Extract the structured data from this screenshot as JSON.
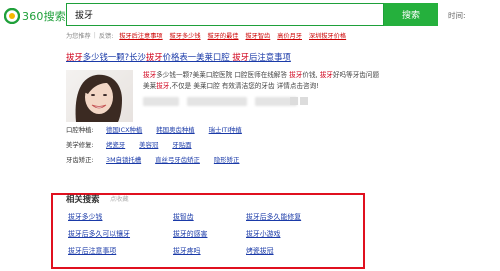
{
  "brand": {
    "logo_text": "360搜索",
    "accent": "#1fa03a",
    "button_color": "#25b03d",
    "highlight_color": "#d0011b",
    "frame_color": "#e0101f"
  },
  "search": {
    "query": "拔牙",
    "button_label": "搜索",
    "time_label": "时间:"
  },
  "suggestions": {
    "prefix": "为您推荐",
    "sep": "|",
    "sub_label": "反馈:",
    "items": [
      "拔牙后注意事项",
      "拔牙多少钱",
      "拔牙的最佳",
      "拔牙智齿",
      "高价月牙",
      "深圳拔牙价格"
    ]
  },
  "result": {
    "title_parts": [
      "拔牙",
      "多少钱一颗?长沙",
      "拔牙",
      "价格表一美莱口腔 ",
      "拔牙",
      "后注意事项"
    ],
    "snippet_parts": [
      "拔牙",
      "多少钱一颗?美莱口腔医院 口腔医师在线解答 ",
      "拔牙",
      "价钱, ",
      "拔牙",
      "好吗等牙齿问题 美莱",
      "拔牙",
      ",不仅是 美莱口腔 有效清洁您的牙齿 详情点击咨询!"
    ],
    "thumb_icon": "smiling-woman-photo",
    "rows": [
      {
        "label": "口腔种植:",
        "values": [
          "德国ICX种植",
          "韩国奥齿种植",
          "瑞士ITI种植"
        ]
      },
      {
        "label": "美学修复:",
        "values": [
          "烤瓷牙",
          "美容冠",
          "牙贴面"
        ]
      },
      {
        "label": "牙齿矫正:",
        "values": [
          "3M自锁托槽",
          "直丝弓牙齿矫正",
          "隐形矫正"
        ]
      }
    ]
  },
  "related": {
    "title": "相关搜索",
    "subtitle": "点收藏",
    "links": [
      "拔牙多少钱",
      "拔智齿",
      "拔牙后多久能修复",
      "拔牙后多久可以镶牙",
      "拔牙的感害",
      "拔牙小游戏",
      "拔牙后注意事项",
      "拔牙疼吗",
      "烤瓷拔冠"
    ]
  }
}
